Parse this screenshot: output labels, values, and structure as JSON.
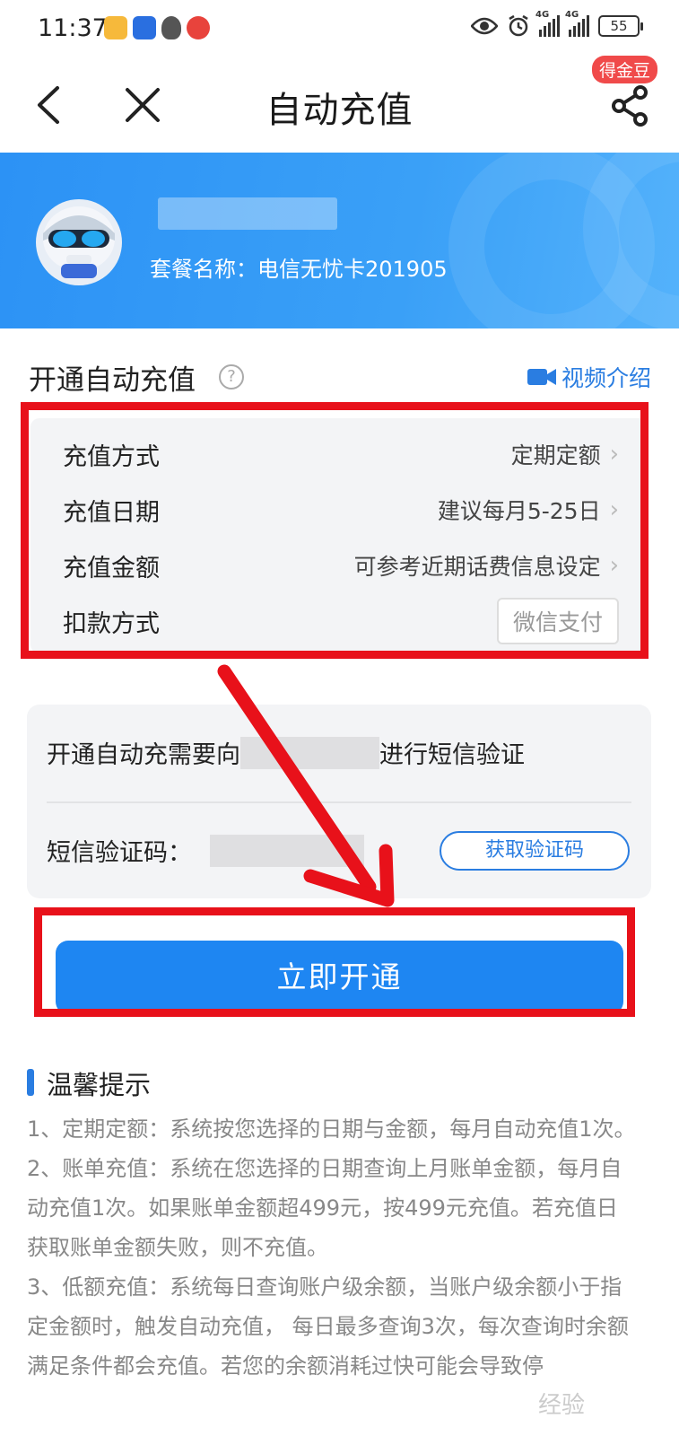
{
  "status_bar": {
    "time": "11:37",
    "network_tag_1": "4G",
    "network_tag_2": "4G",
    "battery": "55"
  },
  "nav": {
    "title": "自动充值",
    "gold_badge": "得金豆"
  },
  "account": {
    "package_name": "套餐名称：电信无忧卡201905"
  },
  "auto_recharge": {
    "section_title": "开通自动充值",
    "help_glyph": "?",
    "video_link": "视频介绍",
    "rows": [
      {
        "label": "充值方式",
        "value": "定期定额"
      },
      {
        "label": "充值日期",
        "value": "建议每月5-25日"
      },
      {
        "label": "充值金额",
        "value": "可参考近期话费信息设定"
      },
      {
        "label": "扣款方式",
        "value": "微信支付"
      }
    ]
  },
  "sms": {
    "prefix": "开通自动充需要向",
    "suffix": "进行短信验证",
    "code_label": "短信验证码：",
    "get_code_button": "获取验证码"
  },
  "primary_button": "立即开通",
  "tips": {
    "title": "温馨提示",
    "items": [
      "1、定期定额：系统按您选择的日期与金额，每月自动充值1次。",
      "2、账单充值：系统在您选择的日期查询上月账单金额，每月自动充值1次。如果账单金额超499元，按499元充值。若充值日获取账单金额失败，则不充值。",
      "3、低额充值：系统每日查询账户级余额，当账户级余额小于指定金额时，触发自动充值， 每日最多查询3次，每次查询时余额满足条件都会充值。若您的余额消耗过快可能会导致停"
    ]
  },
  "watermark": "经验",
  "colors": {
    "brand_blue": "#1e86f2",
    "banner_blue": "#2c92f5",
    "highlight_red": "#e8111a",
    "badge_red": "#f04a4a"
  }
}
